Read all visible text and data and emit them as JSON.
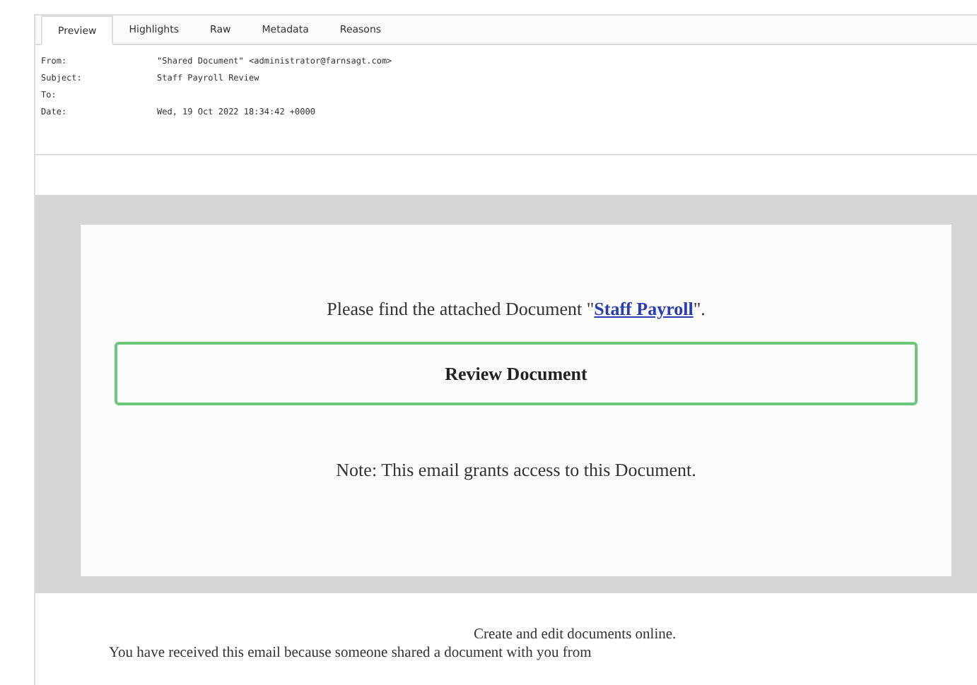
{
  "tabs": [
    {
      "label": "Preview",
      "selected": true
    },
    {
      "label": "Highlights",
      "selected": false
    },
    {
      "label": "Raw",
      "selected": false
    },
    {
      "label": "Metadata",
      "selected": false
    },
    {
      "label": "Reasons",
      "selected": false
    }
  ],
  "headers": [
    {
      "label": "From:",
      "value": "\"Shared Document\" <administrator@farnsagt.com>"
    },
    {
      "label": "Subject:",
      "value": "Staff Payroll Review"
    },
    {
      "label": "To:"
    },
    {
      "label": "Date:",
      "value": "Wed, 19 Oct 2022 18:34:42 +0000"
    }
  ],
  "message": {
    "intro_before": "Please find the attached Document \"",
    "link": "Staff Payroll",
    "intro_after": "\".",
    "button": "Review Document",
    "note": "Note: This email grants access to this Document."
  },
  "footer": [
    "Create and edit documents online.",
    "You have received this email because someone shared a document with you from"
  ]
}
